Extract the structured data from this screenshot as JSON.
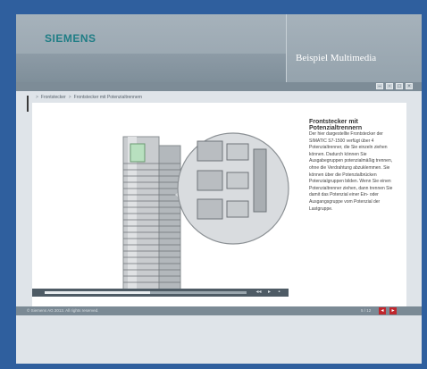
{
  "header": {
    "logo_text": "SIEMENS",
    "app_title": "Beispiel Multimedia"
  },
  "toolbar": {
    "icons": [
      "minimize-icon",
      "restore-icon",
      "window-icon",
      "close-icon"
    ]
  },
  "breadcrumb": {
    "items": [
      "Frontstecker",
      "Frontstecker mit Potenzialtrennern"
    ]
  },
  "content": {
    "title": "Frontstecker mit Potenzialtrennern",
    "text": "Der hier dargestellte Frontstecker der SIMATIC S7-1500 verfügt über 4 Potenzialtrenner, die Sie einzeln ziehen können. Dadurch können Sie Ausgabegruppen potenzialmäßig trennen, ohne die Verdrahtung abzuklemmen. Sie können über die Potenzialbrücken Potenzialgruppen bilden. Wenn Sie einen Potenzialtrenner ziehen, dann trennen Sie damit das Potenzial einer Ein- oder Ausgangsgruppe vom Potenzial der Lastgruppe."
  },
  "player": {
    "progress": 0.52
  },
  "footer": {
    "copyright": "© Siemens AG 2013. All rights reserved.",
    "page": "5 / 12"
  },
  "colors": {
    "frame_blue": "#2f5f9e",
    "logo_teal": "#1f7d85",
    "nav_red": "#c0272d"
  }
}
